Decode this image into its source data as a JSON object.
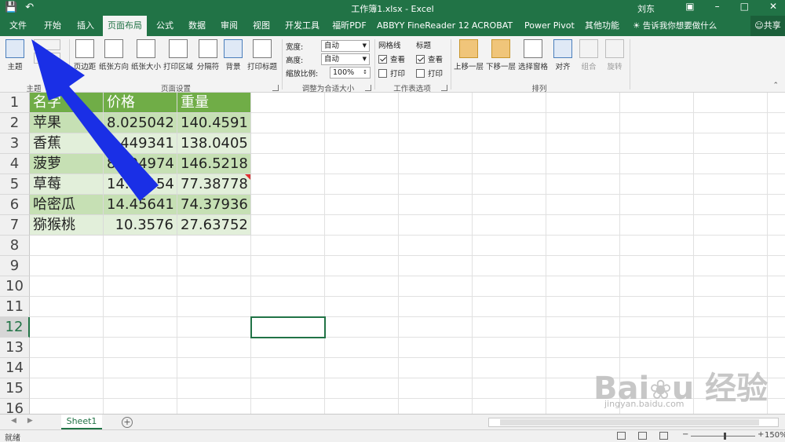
{
  "titlebar": {
    "doc_title": "工作簿1.xlsx  -  Excel",
    "user": "刘东",
    "save_icon": "save-icon",
    "undo_icon": "undo-icon"
  },
  "tabs": [
    "文件",
    "开始",
    "插入",
    "页面布局",
    "公式",
    "数据",
    "审阅",
    "视图",
    "开发工具",
    "福昕PDF",
    "ABBYY FineReader 12",
    "ACROBAT",
    "Power Pivot",
    "其他功能"
  ],
  "active_tab": "页面布局",
  "tell_me": "告诉我你想要做什么",
  "share": "共享",
  "ribbon": {
    "themes": "主题",
    "theme_group": "主题",
    "page_setup_buttons": [
      "页边距",
      "纸张方向",
      "纸张大小",
      "打印区域",
      "分隔符",
      "背景",
      "打印标题"
    ],
    "page_setup_group": "页面设置",
    "fit": {
      "width_label": "宽度:",
      "width_value": "自动",
      "height_label": "高度:",
      "height_value": "自动",
      "scale_label": "缩放比例:",
      "scale_value": "100%",
      "group": "调整为合适大小"
    },
    "sheet_options": {
      "gridlines": "网格线",
      "headings": "标题",
      "view": "查看",
      "print": "打印",
      "group": "工作表选项"
    },
    "arrange_buttons": [
      "上移一层",
      "下移一层",
      "选择窗格",
      "对齐",
      "组合",
      "旋转"
    ],
    "arrange_group": "排列"
  },
  "row_numbers": [
    "1",
    "2",
    "3",
    "4",
    "5",
    "6",
    "7",
    "8",
    "9",
    "10",
    "11",
    "12",
    "13",
    "14",
    "15",
    "16"
  ],
  "selected_row": "12",
  "table": {
    "headers": [
      "名字",
      "价格",
      "重量"
    ],
    "rows": [
      [
        "苹果",
        "8.025042",
        "140.4591"
      ],
      [
        "香蕉",
        "0.449341",
        "138.0405"
      ],
      [
        "菠萝",
        "8.704974",
        "146.5218"
      ],
      [
        "草莓",
        "14.46154",
        "77.38778"
      ],
      [
        "哈密瓜",
        "14.45641",
        "74.37936"
      ],
      [
        "猕猴桃",
        "10.3576",
        "27.63752"
      ]
    ]
  },
  "sheet_tab": "Sheet1",
  "status": {
    "ready": "就绪",
    "zoom": "150%"
  },
  "watermark": {
    "text": "Baidu经验",
    "url": "jingyan.baidu.com"
  },
  "colors": {
    "excel_green": "#217346",
    "table_header": "#70ad47",
    "band": "#c6e0b4",
    "arrow": "#1a2fe6"
  }
}
